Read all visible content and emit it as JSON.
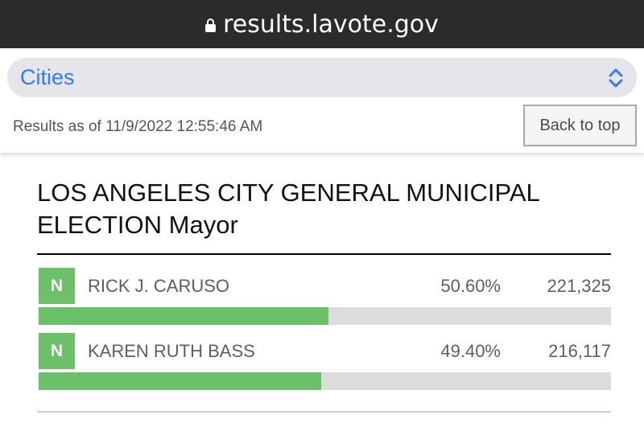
{
  "browser": {
    "url": "results.lavote.gov",
    "lock_icon": "lock-icon"
  },
  "header": {
    "selector": {
      "label": "Cities",
      "icon": "chevron-updown-icon"
    },
    "results_time": "Results as of 11/9/2022 12:55:46 AM",
    "back_to_top_label": "Back to top"
  },
  "contest": {
    "title": "LOS ANGELES CITY GENERAL MUNICIPAL ELECTION Mayor",
    "candidates": [
      {
        "party": "N",
        "name": "RICK J. CARUSO",
        "percent": "50.60%",
        "votes": "221,325",
        "bar_fraction": 0.506
      },
      {
        "party": "N",
        "name": "KAREN RUTH BASS",
        "percent": "49.40%",
        "votes": "216,117",
        "bar_fraction": 0.494
      }
    ]
  },
  "colors": {
    "accent_blue": "#2f7cf6",
    "bar_green": "#6cc069",
    "bar_track": "#dcdcdc",
    "url_bar": "#2b2b2b"
  }
}
